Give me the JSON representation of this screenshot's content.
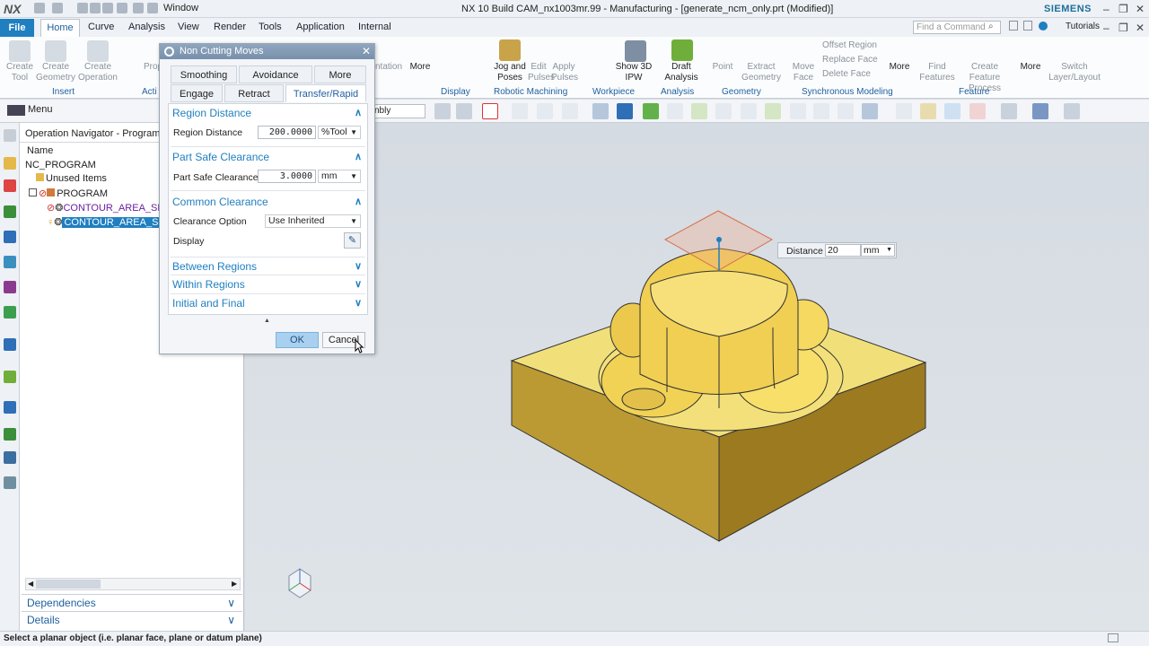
{
  "titlebar": {
    "logo": "NX",
    "window_menu": "Window",
    "title": "NX 10  Build CAM_nx1003mr.99 - Manufacturing - [generate_ncm_only.prt (Modified)]",
    "brand": "SIEMENS",
    "min": "–",
    "restore": "❐",
    "close": "✕"
  },
  "menu": {
    "file": "File",
    "tabs": [
      "Home",
      "Curve",
      "Analysis",
      "View",
      "Render",
      "Tools",
      "Application",
      "Internal"
    ],
    "find_placeholder": "Find a Command",
    "tutorials": "Tutorials"
  },
  "ribbon": {
    "create_tool": "Create Tool",
    "create_geometry": "Create Geometry",
    "create_operation": "Create Operation",
    "prop_partial": "Prop",
    "more1": "More",
    "jog_and_poses": "Jog and Poses",
    "edit_pulses": "Edit Pulses",
    "apply_pulses": "Apply Pulses",
    "show_3d_ipw": "Show 3D IPW",
    "draft_analysis": "Draft Analysis",
    "point": "Point",
    "extract_geometry": "Extract Geometry",
    "move_face": "Move Face",
    "offset_region": "Offset Region",
    "replace_face": "Replace Face",
    "delete_face": "Delete Face",
    "more2": "More",
    "find_features": "Find Features",
    "create_feature_process": "Create Feature Process",
    "more3": "More",
    "switch_layer": "Switch Layer/Layout",
    "ntation_partial": "ntation",
    "groups": {
      "insert": "Insert",
      "actions_partial": "Acti",
      "display": "Display",
      "robotic_machining": "Robotic Machining",
      "workpiece": "Workpiece",
      "analysis": "Analysis",
      "geometry": "Geometry",
      "synchronous_modeling": "Synchronous Modeling",
      "feature": "Feature"
    }
  },
  "toolbar": {
    "menu": "Menu",
    "assembly_partial": "nbly"
  },
  "navigator": {
    "title": "Operation Navigator - Program O",
    "column_name": "Name",
    "items": [
      "NC_PROGRAM",
      "Unused Items",
      "PROGRAM",
      "CONTOUR_AREA_SEMI",
      "CONTOUR_AREA_SEMI"
    ],
    "dependencies": "Dependencies",
    "details": "Details"
  },
  "dialog": {
    "title": "Non Cutting Moves",
    "tabs_row1": [
      "Smoothing",
      "Avoidance",
      "More"
    ],
    "tabs_row2": [
      "Engage",
      "Retract",
      "Transfer/Rapid"
    ],
    "sections": {
      "region_distance": "Region Distance",
      "part_safe_clearance": "Part Safe Clearance",
      "common_clearance": "Common Clearance",
      "between_regions": "Between Regions",
      "within_regions": "Within Regions",
      "initial_and_final": "Initial and Final"
    },
    "fields": {
      "region_distance_label": "Region Distance",
      "region_distance_value": "200.0000",
      "region_distance_unit": "%Tool",
      "part_safe_label": "Part Safe Clearance",
      "part_safe_value": "3.0000",
      "part_safe_unit": "mm",
      "clearance_option_label": "Clearance Option",
      "clearance_option_value": "Use Inherited",
      "display_label": "Display"
    },
    "ok": "OK",
    "cancel": "Cancel"
  },
  "distance_box": {
    "label": "Distance",
    "value": "20",
    "unit": "mm"
  },
  "status": {
    "message": "Select a planar object (i.e. planar face, plane or datum plane)"
  },
  "colors": {
    "accent": "#1f7fc0",
    "part_yellow": "#f0d96a",
    "part_side": "#b8952c",
    "selection": "#1f7fc0"
  }
}
